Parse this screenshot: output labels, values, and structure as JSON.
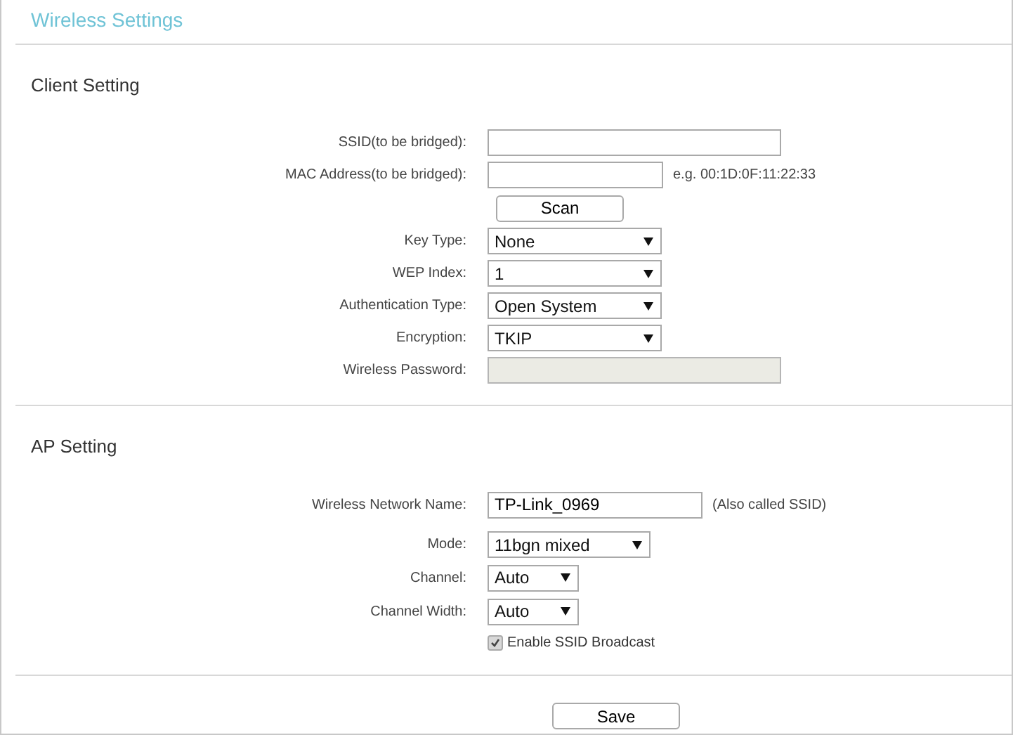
{
  "title": "Wireless Settings",
  "sections": [
    {
      "heading": "Client Setting",
      "rows": [
        {
          "kind": "field",
          "label": "SSID(to be bridged):"
        },
        {
          "kind": "mac-field",
          "label": "MAC Address(to be bridged):",
          "hint": "e.g. 00:1D:0F:11:22:33"
        },
        {
          "kind": "button",
          "text": "Scan"
        },
        {
          "kind": "select",
          "label": "Key Type:",
          "value": "None"
        },
        {
          "kind": "select",
          "label": "WEP Index:",
          "value": "1"
        },
        {
          "kind": "select",
          "label": "Authentication Type:",
          "value": "Open System"
        },
        {
          "kind": "select",
          "label": "Encryption:",
          "value": "TKIP"
        },
        {
          "kind": "disabled-field",
          "label": "Wireless Password:"
        }
      ]
    },
    {
      "heading": "AP Setting",
      "rows": [
        {
          "kind": "name-field",
          "label": "Wireless Network Name:",
          "value": "TP-Link_0969",
          "hint": "(Also called SSID)"
        },
        {
          "kind": "mode-select",
          "label": "Mode:",
          "value": "11bgn mixed"
        },
        {
          "kind": "small-select",
          "label": "Channel:",
          "value": "Auto"
        },
        {
          "kind": "small-select",
          "label": "Channel Width:",
          "value": "Auto"
        },
        {
          "kind": "checkbox",
          "text": "Enable SSID Broadcast",
          "checked": true
        }
      ]
    }
  ],
  "save": "Save"
}
